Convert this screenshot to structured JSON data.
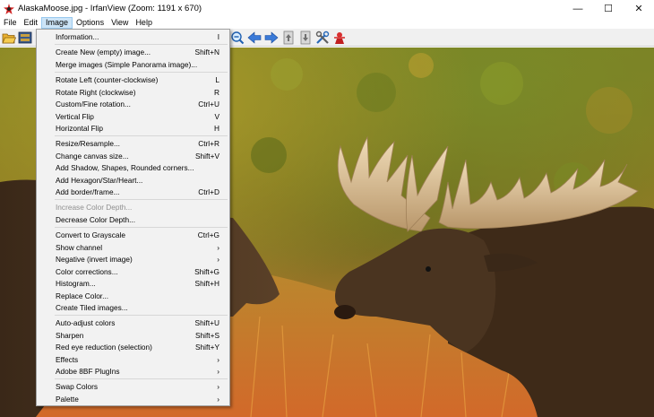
{
  "window": {
    "title": "AlaskaMoose.jpg - IrfanView (Zoom: 1191 x 670)",
    "minimize_glyph": "—",
    "maximize_glyph": "☐",
    "close_glyph": "✕"
  },
  "menubar": {
    "items": [
      {
        "label": "File"
      },
      {
        "label": "Edit"
      },
      {
        "label": "Image"
      },
      {
        "label": "Options"
      },
      {
        "label": "View"
      },
      {
        "label": "Help"
      }
    ]
  },
  "toolbar": {
    "icons": [
      "open-folder-icon",
      "thumbnails-icon",
      "zoom-out-icon",
      "previous-icon",
      "next-icon",
      "copy-icon",
      "paste-icon",
      "settings-icon",
      "exit-icon"
    ]
  },
  "image_menu": {
    "items": [
      {
        "label": "Information...",
        "shortcut": "I"
      },
      {
        "label": "Create New (empty) image...",
        "shortcut": "Shift+N"
      },
      {
        "label": "Merge images (Simple Panorama image)...",
        "shortcut": ""
      },
      {
        "label": "Rotate Left (counter-clockwise)",
        "shortcut": "L"
      },
      {
        "label": "Rotate Right (clockwise)",
        "shortcut": "R"
      },
      {
        "label": "Custom/Fine rotation...",
        "shortcut": "Ctrl+U"
      },
      {
        "label": "Vertical Flip",
        "shortcut": "V"
      },
      {
        "label": "Horizontal Flip",
        "shortcut": "H"
      },
      {
        "label": "Resize/Resample...",
        "shortcut": "Ctrl+R"
      },
      {
        "label": "Change canvas size...",
        "shortcut": "Shift+V"
      },
      {
        "label": "Add Shadow, Shapes, Rounded corners...",
        "shortcut": ""
      },
      {
        "label": "Add Hexagon/Star/Heart...",
        "shortcut": ""
      },
      {
        "label": "Add border/frame...",
        "shortcut": "Ctrl+D"
      },
      {
        "label": "Increase Color Depth...",
        "shortcut": ""
      },
      {
        "label": "Decrease Color Depth...",
        "shortcut": ""
      },
      {
        "label": "Convert to Grayscale",
        "shortcut": "Ctrl+G"
      },
      {
        "label": "Show channel",
        "shortcut": "›"
      },
      {
        "label": "Negative (invert image)",
        "shortcut": "›"
      },
      {
        "label": "Color corrections...",
        "shortcut": "Shift+G"
      },
      {
        "label": "Histogram...",
        "shortcut": "Shift+H"
      },
      {
        "label": "Replace Color...",
        "shortcut": ""
      },
      {
        "label": "Create Tiled images...",
        "shortcut": ""
      },
      {
        "label": "Auto-adjust colors",
        "shortcut": "Shift+U"
      },
      {
        "label": "Sharpen",
        "shortcut": "Shift+S"
      },
      {
        "label": "Red eye reduction (selection)",
        "shortcut": "Shift+Y"
      },
      {
        "label": "Effects",
        "shortcut": "›"
      },
      {
        "label": "Adobe 8BF PlugIns",
        "shortcut": "›"
      },
      {
        "label": "Swap Colors",
        "shortcut": "›"
      },
      {
        "label": "Palette",
        "shortcut": "›"
      }
    ]
  },
  "colors": {
    "menu_highlight": "#cce4f7",
    "menu_bg": "#f2f2f2",
    "disabled_text": "#8f8f8f"
  }
}
